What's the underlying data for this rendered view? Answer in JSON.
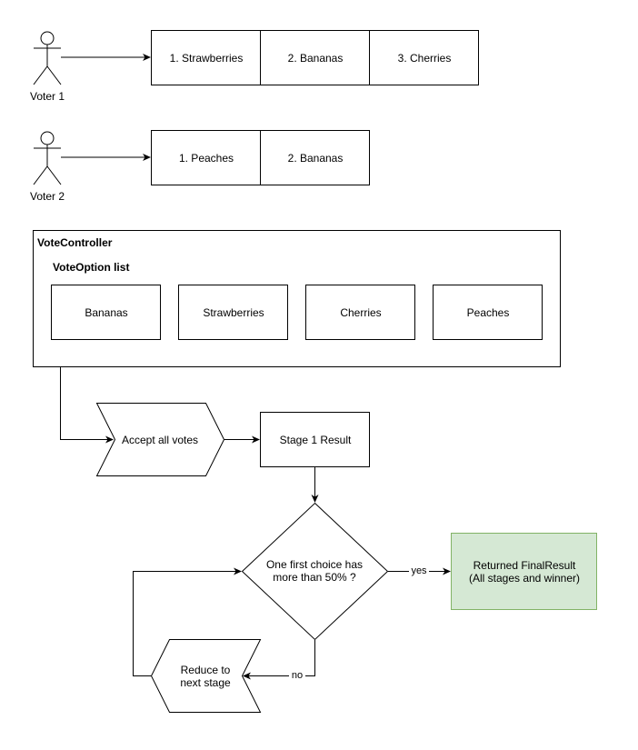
{
  "voters": [
    {
      "label": "Voter 1",
      "choices": [
        "1. Strawberries",
        "2. Bananas",
        "3. Cherries"
      ]
    },
    {
      "label": "Voter 2",
      "choices": [
        "1. Peaches",
        "2. Bananas"
      ]
    }
  ],
  "controller": {
    "title": "VoteController",
    "list_title": "VoteOption list",
    "options": [
      "Bananas",
      "Strawberries",
      "Cherries",
      "Peaches"
    ]
  },
  "flow": {
    "accept": "Accept all votes",
    "stage1": "Stage 1 Result",
    "decision": "One first choice has more than 50% ?",
    "yes_label": "yes",
    "no_label": "no",
    "result_line1": "Returned FinalResult",
    "result_line2": "(All stages and winner)",
    "reduce": "Reduce to next stage"
  },
  "colors": {
    "result_fill": "#d5e8d4",
    "result_stroke": "#82b366"
  }
}
